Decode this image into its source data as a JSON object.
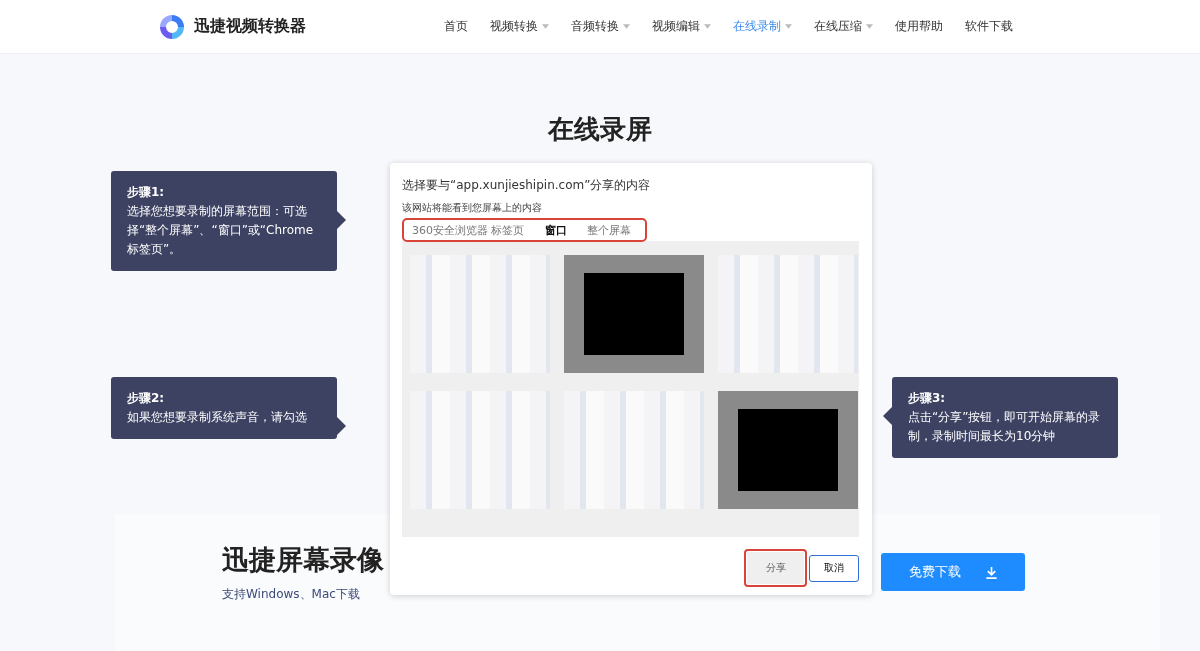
{
  "header": {
    "logo_text": "迅捷视频转换器",
    "nav": [
      {
        "label": "首页",
        "selected": false,
        "has_dropdown": false
      },
      {
        "label": "视频转换",
        "selected": false,
        "has_dropdown": true
      },
      {
        "label": "音频转换",
        "selected": false,
        "has_dropdown": true
      },
      {
        "label": "视频编辑",
        "selected": false,
        "has_dropdown": true
      },
      {
        "label": "在线录制",
        "selected": true,
        "has_dropdown": true
      },
      {
        "label": "在线压缩",
        "selected": false,
        "has_dropdown": true
      },
      {
        "label": "使用帮助",
        "selected": false,
        "has_dropdown": false
      },
      {
        "label": "软件下载",
        "selected": false,
        "has_dropdown": false
      }
    ]
  },
  "page_title": "在线录屏",
  "steps": [
    {
      "title": "步骤1:",
      "text": "选择您想要录制的屏幕范围：可选择“整个屏幕”、“窗口”或“Chrome标签页”。"
    },
    {
      "title": "步骤2:",
      "text": "如果您想要录制系统声音，请勾选"
    },
    {
      "title": "步骤3:",
      "text": "点击“分享”按钮，即可开始屏幕的录制，录制时间最长为10分钟"
    }
  ],
  "share_dialog": {
    "title": "选择要与“app.xunjieshipin.com”分享的内容",
    "subtitle": "该网站将能看到您屏幕上的内容",
    "tabs": [
      {
        "label": "360安全浏览器 标签页",
        "selected": false
      },
      {
        "label": "窗口",
        "selected": true
      },
      {
        "label": "整个屏幕",
        "selected": false
      }
    ],
    "thumbnails": [
      {
        "kind": "light"
      },
      {
        "kind": "dark"
      },
      {
        "kind": "light"
      },
      {
        "kind": "light"
      },
      {
        "kind": "light"
      },
      {
        "kind": "dark"
      }
    ],
    "share_button": "分享",
    "cancel_button": "取消"
  },
  "promo": {
    "title": "迅捷屏幕录像",
    "subtitle": "支持Windows、Mac下载",
    "download_button": "免费下载"
  }
}
